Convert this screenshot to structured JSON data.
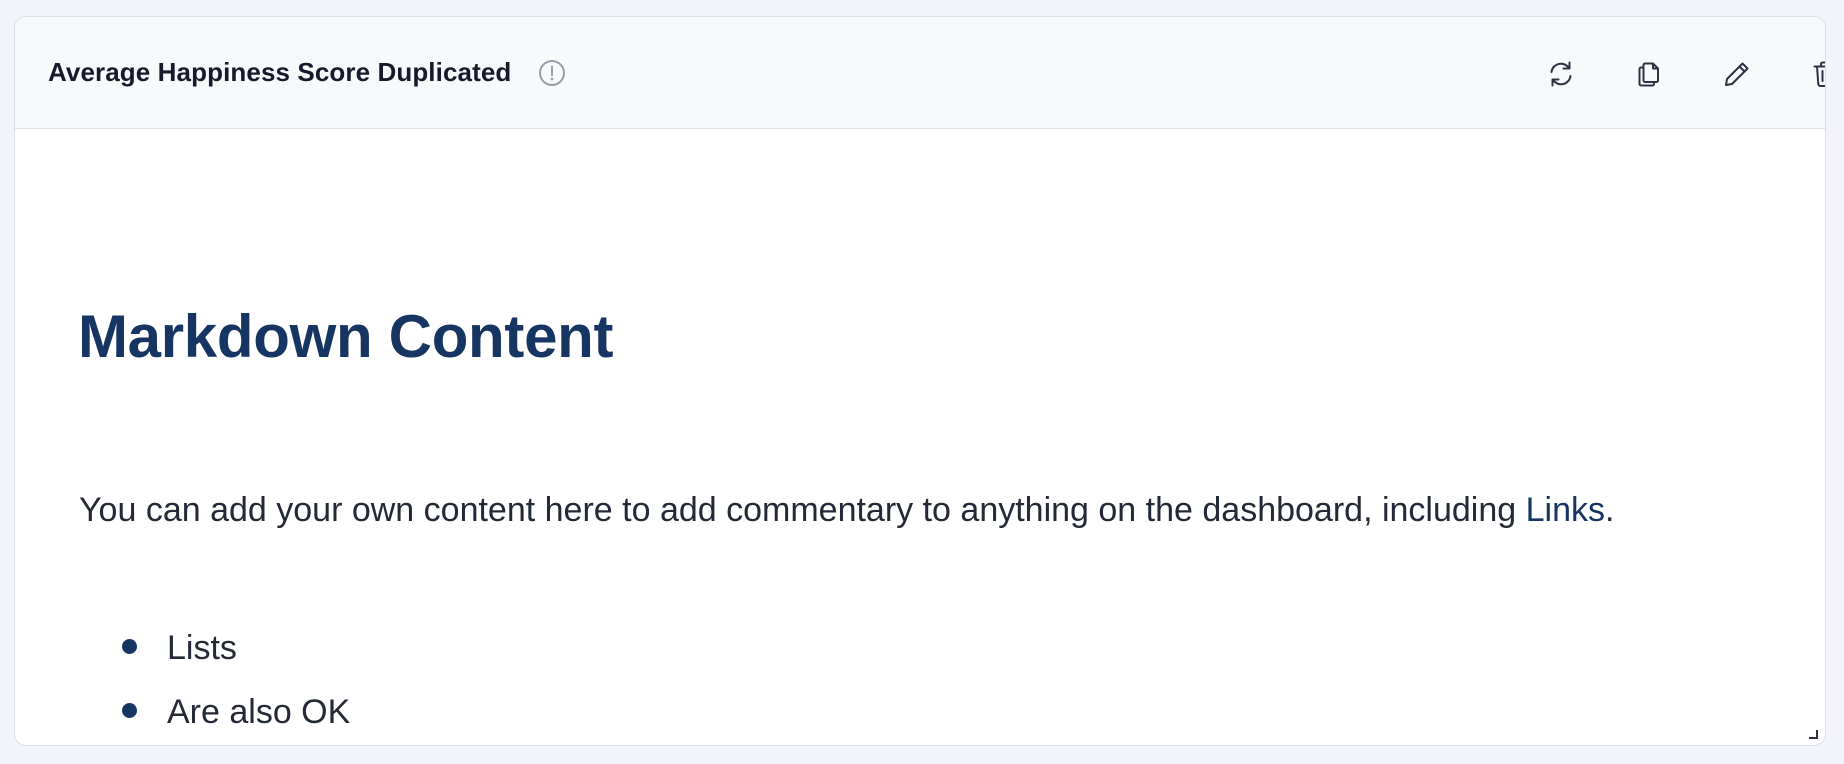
{
  "panel": {
    "title": "Average Happiness Score Duplicated",
    "info_icon": "info-circle-icon",
    "actions": [
      {
        "icon": "refresh-icon",
        "label": "Refresh"
      },
      {
        "icon": "duplicate-icon",
        "label": "Duplicate"
      },
      {
        "icon": "edit-icon",
        "label": "Edit"
      },
      {
        "icon": "delete-icon",
        "label": "Delete"
      }
    ]
  },
  "markdown": {
    "heading": "Markdown Content",
    "paragraph_text": "You can add your own content here to add commentary to anything on the dashboard, including ",
    "link_text": "Links",
    "paragraph_end": ".",
    "list_items": [
      "Lists",
      "Are also OK"
    ]
  },
  "colors": {
    "heading": "#173563",
    "link": "#173563",
    "text": "#232936",
    "page_background": "#f2f3fb",
    "header_background": "#f8f9fb"
  }
}
